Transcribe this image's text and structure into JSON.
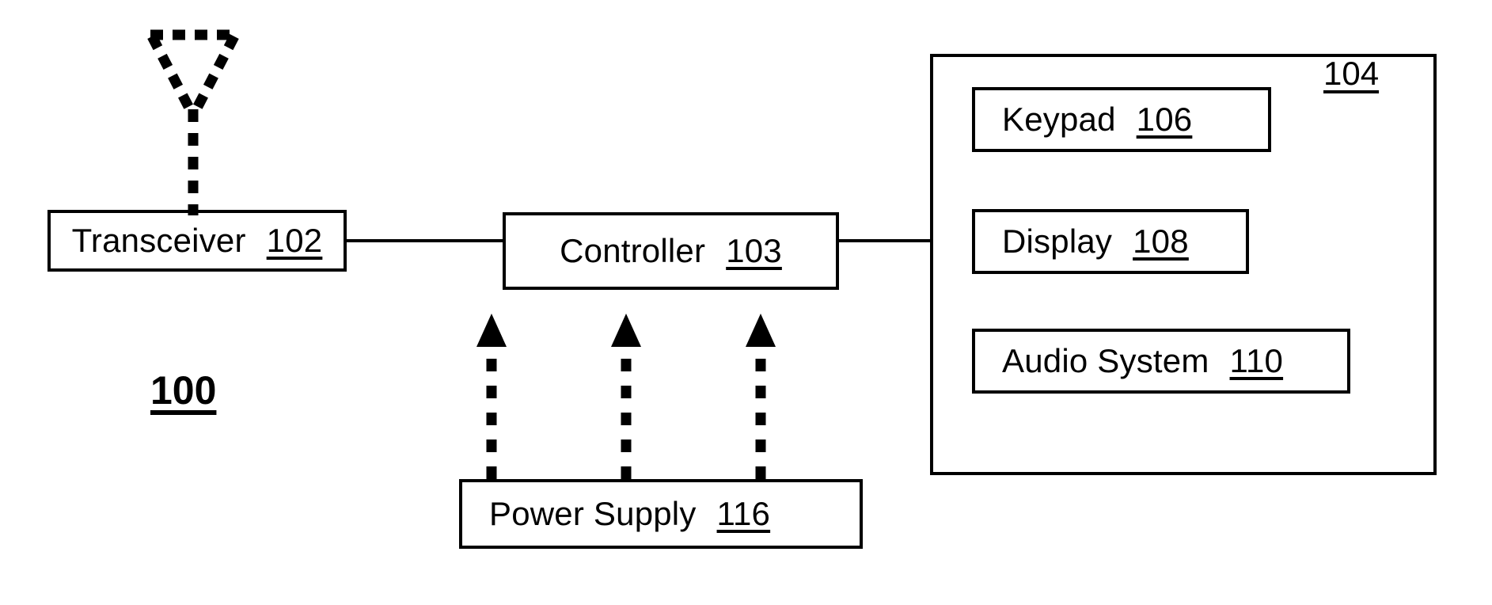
{
  "figure": {
    "number": "100",
    "type": "patent-block-diagram"
  },
  "blocks": {
    "transceiver": {
      "label": "Transceiver",
      "ref": "102"
    },
    "controller": {
      "label": "Controller",
      "ref": "103"
    },
    "keypad": {
      "label": "Keypad",
      "ref": "106"
    },
    "display": {
      "label": "Display",
      "ref": "108"
    },
    "audio_system": {
      "label": "Audio System",
      "ref": "110"
    },
    "power_supply": {
      "label": "Power Supply",
      "ref": "116"
    }
  },
  "enclosure": {
    "ref": "104"
  },
  "icons": {
    "antenna": "antenna-icon",
    "power_arrow": "power-arrow-icon"
  },
  "colors": {
    "stroke": "#000000",
    "background": "#ffffff"
  }
}
